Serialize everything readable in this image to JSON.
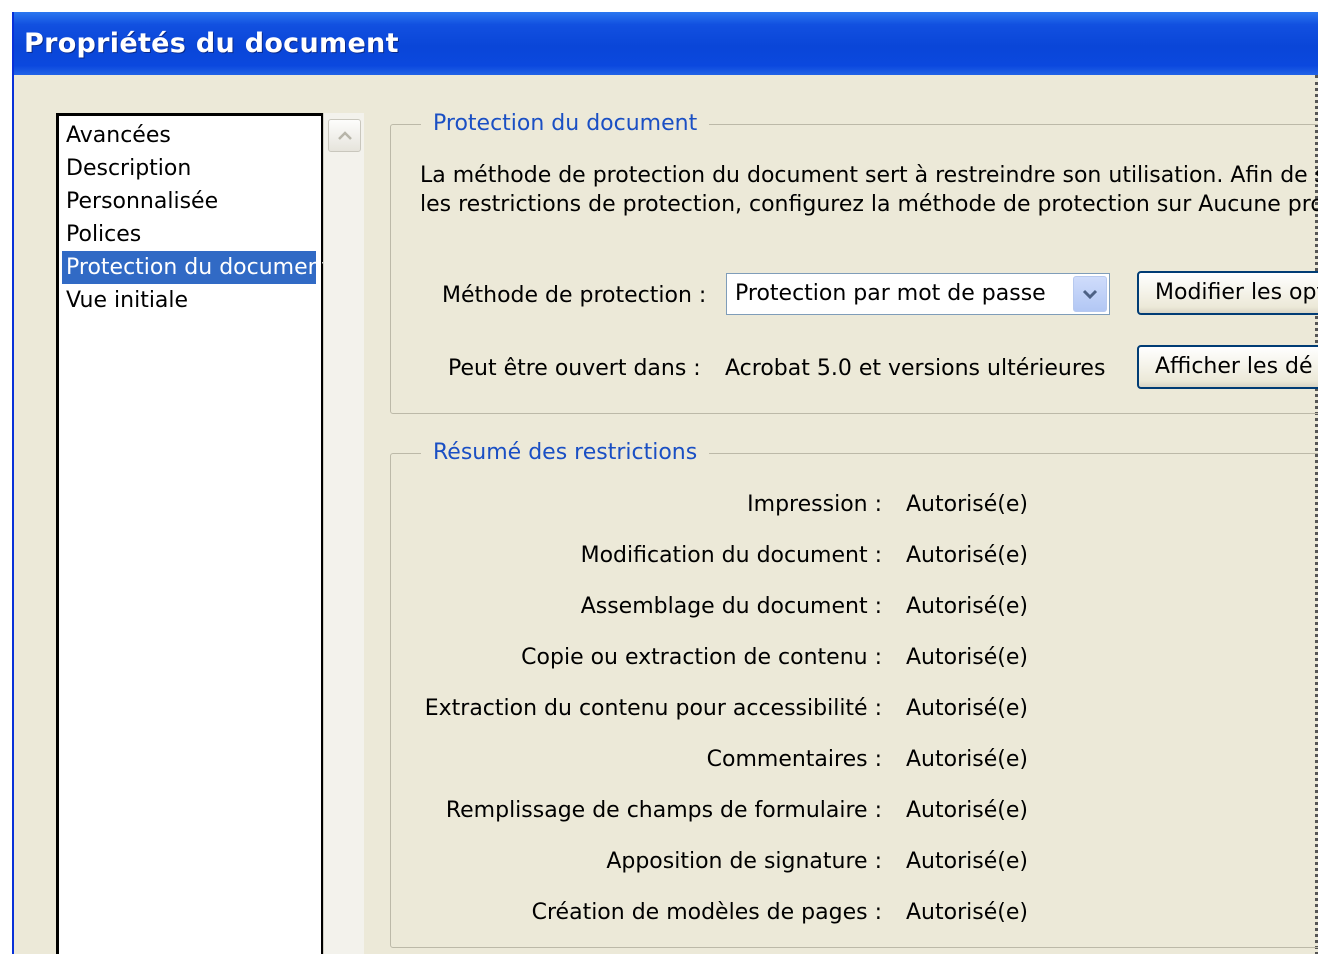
{
  "window": {
    "title": "Propriétés du document"
  },
  "categories": [
    {
      "label": "Avancées",
      "selected": false
    },
    {
      "label": "Description",
      "selected": false
    },
    {
      "label": "Personnalisée",
      "selected": false
    },
    {
      "label": "Polices",
      "selected": false
    },
    {
      "label": "Protection du document",
      "selected": true
    },
    {
      "label": "Vue initiale",
      "selected": false
    }
  ],
  "protection": {
    "legend": "Protection du document",
    "description_line1": "La méthode de protection du document sert à restreindre son utilisation. Afin de sup",
    "description_line2": "les restrictions de protection, configurez la méthode de protection sur Aucune prote",
    "method_label": "Méthode de protection :",
    "method_value": "Protection par mot de passe",
    "modify_button": "Modifier les opt",
    "opened_in_label": "Peut être ouvert dans :",
    "opened_in_value": "Acrobat 5.0 et versions ultérieures",
    "details_button": "Afficher les dé"
  },
  "restrictions": {
    "legend": "Résumé des restrictions",
    "rows": [
      {
        "label": "Impression :",
        "value": "Autorisé(e)"
      },
      {
        "label": "Modification du document :",
        "value": "Autorisé(e)"
      },
      {
        "label": "Assemblage du document :",
        "value": "Autorisé(e)"
      },
      {
        "label": "Copie ou extraction de contenu :",
        "value": "Autorisé(e)"
      },
      {
        "label": "Extraction du contenu pour accessibilité :",
        "value": "Autorisé(e)"
      },
      {
        "label": "Commentaires :",
        "value": "Autorisé(e)"
      },
      {
        "label": "Remplissage de champs de formulaire :",
        "value": "Autorisé(e)"
      },
      {
        "label": "Apposition de signature :",
        "value": "Autorisé(e)"
      },
      {
        "label": "Création de modèles de pages :",
        "value": "Autorisé(e)"
      }
    ]
  }
}
